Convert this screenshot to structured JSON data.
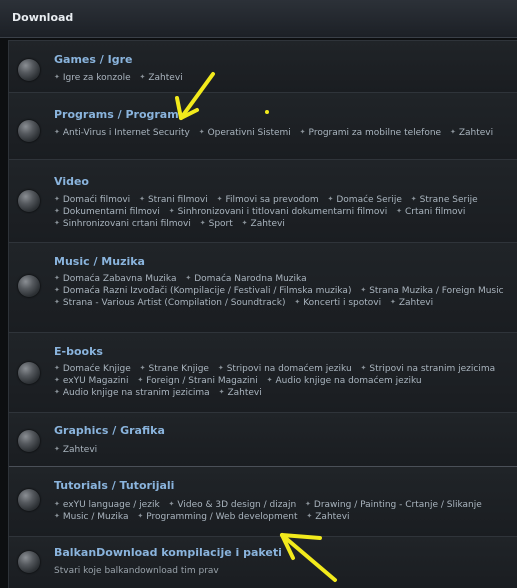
{
  "header": {
    "title": "Download"
  },
  "forums": [
    {
      "title": "Games / Igre",
      "subforums": [
        "Igre za konzole",
        "Zahtevi"
      ]
    },
    {
      "title": "Programs / Programi",
      "subforums": [
        "Anti-Virus i Internet Security",
        "Operativni Sistemi",
        "Programi za mobilne telefone",
        "Zahtevi"
      ]
    },
    {
      "title": "Video",
      "subforums": [
        "Domaći filmovi",
        "Strani filmovi",
        "Filmovi sa prevodom",
        "Domaće Serije",
        "Strane Serije",
        "Dokumentarni filmovi",
        "Sinhronizovani i titlovani dokumentarni filmovi",
        "Crtani filmovi",
        "Sinhronizovani crtani filmovi",
        "Sport",
        "Zahtevi"
      ]
    },
    {
      "title": "Music / Muzika",
      "subforums": [
        "Domaća Zabavna Muzika",
        "Domaća Narodna Muzika",
        "Domaća Razni Izvođači (Kompilacije / Festivali / Filmska muzika)",
        "Strana Muzika / Foreign Music",
        "Strana - Various Artist (Compilation / Soundtrack)",
        "Koncerti i spotovi",
        "Zahtevi"
      ]
    },
    {
      "title": "E-books",
      "subforums": [
        "Domaće Knjige",
        "Strane Knjige",
        "Stripovi na domaćem jeziku",
        "Stripovi na stranim jezicima",
        "exYU Magazini",
        "Foreign / Strani Magazini",
        "Audio knjige na domaćem jeziku",
        "Audio knjige na stranim jezicima",
        "Zahtevi"
      ]
    },
    {
      "title": "Graphics / Grafika",
      "subforums": [
        "Zahtevi"
      ]
    },
    {
      "title": "Tutorials / Tutorijali",
      "subforums": [
        "exYU language / jezik",
        "Video & 3D design / dizajn",
        "Drawing / Painting - Crtanje / Slikanje",
        "Music / Muzika",
        "Programming / Web development",
        "Zahtevi"
      ]
    },
    {
      "title": "BalkanDownload kompilacije i paketi",
      "description": "Stvari koje balkandownload tim prav"
    }
  ],
  "colors": {
    "annotation": "#f2ea1c",
    "title_link": "#8ab4dd"
  },
  "icons": {
    "forum_bullet": "forum-status-icon",
    "subforum_bullet": "diamond-bullet-icon"
  }
}
